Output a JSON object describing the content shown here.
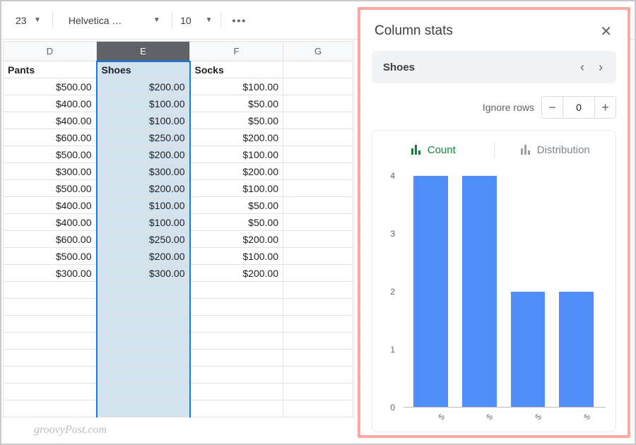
{
  "toolbar": {
    "number": "23",
    "font": "Helvetica …",
    "size": "10",
    "more": "•••"
  },
  "columns": {
    "D": "D",
    "E": "E",
    "F": "F",
    "G": "G"
  },
  "headers": {
    "D": "Pants",
    "E": "Shoes",
    "F": "Socks"
  },
  "rows": [
    {
      "D": "$500.00",
      "E": "$200.00",
      "F": "$100.00"
    },
    {
      "D": "$400.00",
      "E": "$100.00",
      "F": "$50.00"
    },
    {
      "D": "$400.00",
      "E": "$100.00",
      "F": "$50.00"
    },
    {
      "D": "$600.00",
      "E": "$250.00",
      "F": "$200.00"
    },
    {
      "D": "$500.00",
      "E": "$200.00",
      "F": "$100.00"
    },
    {
      "D": "$300.00",
      "E": "$300.00",
      "F": "$200.00"
    },
    {
      "D": "$500.00",
      "E": "$200.00",
      "F": "$100.00"
    },
    {
      "D": "$400.00",
      "E": "$100.00",
      "F": "$50.00"
    },
    {
      "D": "$400.00",
      "E": "$100.00",
      "F": "$50.00"
    },
    {
      "D": "$600.00",
      "E": "$250.00",
      "F": "$200.00"
    },
    {
      "D": "$500.00",
      "E": "$200.00",
      "F": "$100.00"
    },
    {
      "D": "$300.00",
      "E": "$300.00",
      "F": "$200.00"
    }
  ],
  "watermark": "groovyPost.com",
  "panel": {
    "title": "Column stats",
    "column": "Shoes",
    "ignore_label": "Ignore rows",
    "ignore_value": "0",
    "tabs": {
      "count": "Count",
      "distribution": "Distribution"
    }
  },
  "chart_data": {
    "type": "bar",
    "categories": [
      "$",
      "$",
      "$",
      "$"
    ],
    "values": [
      4,
      4,
      2,
      2
    ],
    "ylim": [
      0,
      4
    ],
    "yticks": [
      0,
      1,
      2,
      3,
      4
    ],
    "title": "",
    "xlabel": "",
    "ylabel": ""
  },
  "colors": {
    "bar": "#4f8df7",
    "accent": "#188038",
    "annotation": "#f7a8a0"
  }
}
